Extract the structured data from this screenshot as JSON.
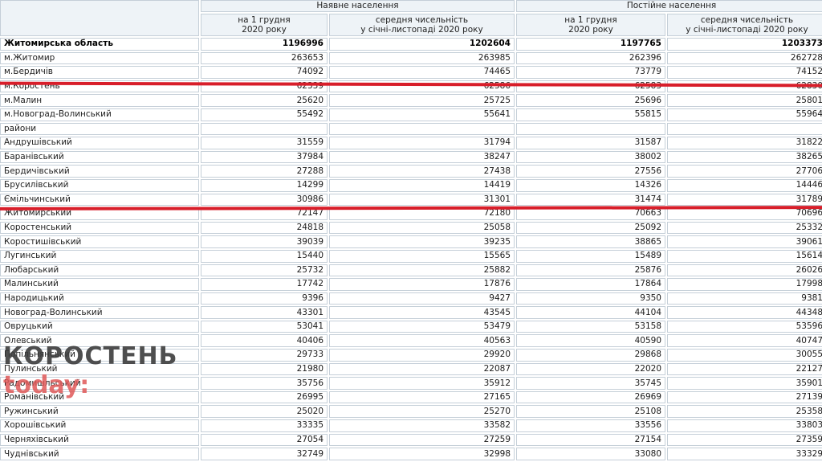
{
  "header": {
    "group_present": "Наявне населення",
    "group_permanent": "Постійне населення",
    "col_dec1": "на 1 грудня\n2020 року",
    "col_avg": "середня чисельність\nу січні-листопаді 2020 року"
  },
  "rows": [
    {
      "name": "Житомирська область",
      "v": [
        "1196996",
        "1202604",
        "1197765",
        "1203373"
      ],
      "total": true
    },
    {
      "name": "м.Житомир",
      "v": [
        "263653",
        "263985",
        "262396",
        "262728"
      ]
    },
    {
      "name": "м.Бердичів",
      "v": [
        "74092",
        "74465",
        "73779",
        "74152"
      ]
    },
    {
      "name": "м.Коростень",
      "v": [
        "62339",
        "62586",
        "62583",
        "62830"
      ]
    },
    {
      "name": "м.Малин",
      "v": [
        "25620",
        "25725",
        "25696",
        "25801"
      ]
    },
    {
      "name": "м.Новоград-Волинський",
      "v": [
        "55492",
        "55641",
        "55815",
        "55964"
      ]
    },
    {
      "name": "райони",
      "v": [
        "",
        "",
        "",
        ""
      ]
    },
    {
      "name": "Андрушівський",
      "v": [
        "31559",
        "31794",
        "31587",
        "31822"
      ]
    },
    {
      "name": "Баранівський",
      "v": [
        "37984",
        "38247",
        "38002",
        "38265"
      ]
    },
    {
      "name": "Бердичівський",
      "v": [
        "27288",
        "27438",
        "27556",
        "27706"
      ]
    },
    {
      "name": "Брусилівський",
      "v": [
        "14299",
        "14419",
        "14326",
        "14446"
      ]
    },
    {
      "name": "Ємільчинський",
      "v": [
        "30986",
        "31301",
        "31474",
        "31789"
      ]
    },
    {
      "name": "Житомирський",
      "v": [
        "72147",
        "72180",
        "70663",
        "70696"
      ]
    },
    {
      "name": "Коростенський",
      "v": [
        "24818",
        "25058",
        "25092",
        "25332"
      ]
    },
    {
      "name": "Коростишівський",
      "v": [
        "39039",
        "39235",
        "38865",
        "39061"
      ]
    },
    {
      "name": "Лугинський",
      "v": [
        "15440",
        "15565",
        "15489",
        "15614"
      ]
    },
    {
      "name": "Любарський",
      "v": [
        "25732",
        "25882",
        "25876",
        "26026"
      ]
    },
    {
      "name": "Малинський",
      "v": [
        "17742",
        "17876",
        "17864",
        "17998"
      ]
    },
    {
      "name": "Народицький",
      "v": [
        "9396",
        "9427",
        "9350",
        "9381"
      ]
    },
    {
      "name": "Новоград-Волинський",
      "v": [
        "43301",
        "43545",
        "44104",
        "44348"
      ]
    },
    {
      "name": "Овруцький",
      "v": [
        "53041",
        "53479",
        "53158",
        "53596"
      ]
    },
    {
      "name": "Олевський",
      "v": [
        "40406",
        "40563",
        "40590",
        "40747"
      ]
    },
    {
      "name": "Попільнянський",
      "v": [
        "29733",
        "29920",
        "29868",
        "30055"
      ]
    },
    {
      "name": "Пулинський",
      "v": [
        "21980",
        "22087",
        "22020",
        "22127"
      ]
    },
    {
      "name": "Радомишльський",
      "v": [
        "35756",
        "35912",
        "35745",
        "35901"
      ]
    },
    {
      "name": "Романівський",
      "v": [
        "26995",
        "27165",
        "26969",
        "27139"
      ]
    },
    {
      "name": "Ружинський",
      "v": [
        "25020",
        "25270",
        "25108",
        "25358"
      ]
    },
    {
      "name": "Хорошівський",
      "v": [
        "33335",
        "33582",
        "33556",
        "33803"
      ]
    },
    {
      "name": "Черняхівський",
      "v": [
        "27054",
        "27259",
        "27154",
        "27359"
      ]
    },
    {
      "name": "Чуднівський",
      "v": [
        "32749",
        "32998",
        "33080",
        "33329"
      ]
    }
  ],
  "watermark": {
    "line1": "КОРОСТЕНЬ",
    "line2": "today:"
  },
  "colors": {
    "underline": "#d81e2a",
    "header_bg": "#eef3f7",
    "border": "#c5cfd8",
    "watermark_accent": "#e05959"
  }
}
